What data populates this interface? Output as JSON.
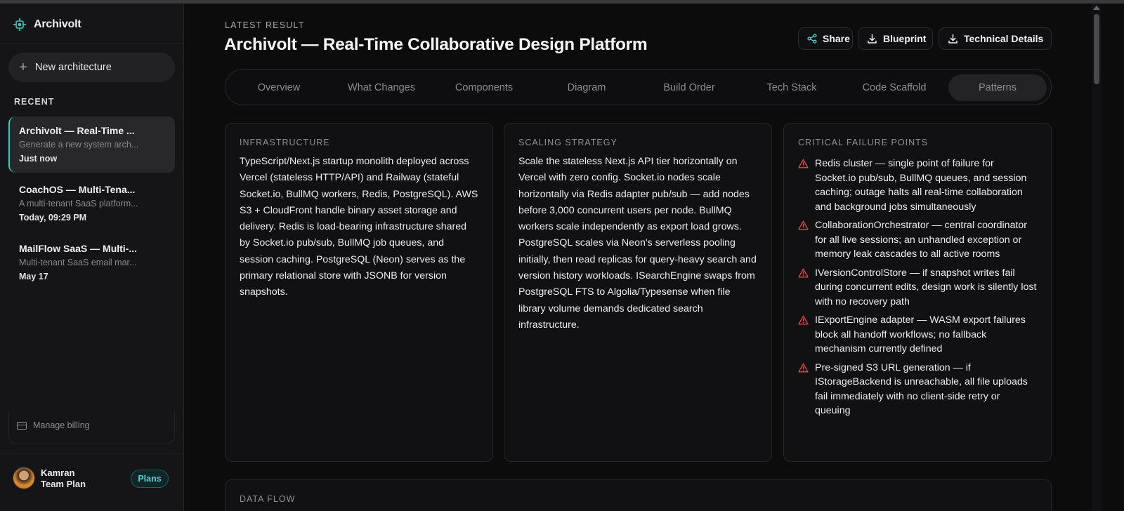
{
  "app": {
    "name": "Archivolt"
  },
  "sidebar": {
    "new_button": "New architecture",
    "recent_title": "RECENT",
    "recent": [
      {
        "title": "Archivolt — Real-Time ...",
        "desc": "Generate a new system arch...",
        "time": "Just now"
      },
      {
        "title": "CoachOS — Multi-Tena...",
        "desc": "A multi-tenant SaaS platform...",
        "time": "Today, 09:29 PM"
      },
      {
        "title": "MailFlow SaaS — Multi-...",
        "desc": "Multi-tenant SaaS email mar...",
        "time": "May 17"
      }
    ],
    "billing": "Manage billing",
    "user": {
      "name": "Kamran",
      "plan": "Team Plan",
      "plans_button": "Plans"
    }
  },
  "header": {
    "overline": "LATEST RESULT",
    "title": "Archivolt — Real-Time Collaborative Design Platform",
    "actions": {
      "share": "Share",
      "blueprint": "Blueprint",
      "technical": "Technical Details"
    }
  },
  "tabs": [
    {
      "label": "Overview"
    },
    {
      "label": "What Changes"
    },
    {
      "label": "Components"
    },
    {
      "label": "Diagram"
    },
    {
      "label": "Build Order"
    },
    {
      "label": "Tech Stack"
    },
    {
      "label": "Code Scaffold"
    },
    {
      "label": "Patterns",
      "active": true
    }
  ],
  "cards": {
    "infrastructure": {
      "label": "INFRASTRUCTURE",
      "text": "TypeScript/Next.js startup monolith deployed across Vercel (stateless HTTP/API) and Railway (stateful Socket.io, BullMQ workers, Redis, PostgreSQL). AWS S3 + CloudFront handle binary asset storage and delivery. Redis is load-bearing infrastructure shared by Socket.io pub/sub, BullMQ job queues, and session caching. PostgreSQL (Neon) serves as the primary relational store with JSONB for version snapshots."
    },
    "scaling": {
      "label": "SCALING STRATEGY",
      "text": "Scale the stateless Next.js API tier horizontally on Vercel with zero config. Socket.io nodes scale horizontally via Redis adapter pub/sub — add nodes before 3,000 concurrent users per node. BullMQ workers scale independently as export load grows. PostgreSQL scales via Neon's serverless pooling initially, then read replicas for query-heavy search and version history workloads. ISearchEngine swaps from PostgreSQL FTS to Algolia/Typesense when file library volume demands dedicated search infrastructure."
    },
    "failures": {
      "label": "CRITICAL FAILURE POINTS",
      "items": [
        "Redis cluster — single point of failure for Socket.io pub/sub, BullMQ queues, and session caching; outage halts all real-time collaboration and background jobs simultaneously",
        "CollaborationOrchestrator — central coordinator for all live sessions; an unhandled exception or memory leak cascades to all active rooms",
        "IVersionControlStore — if snapshot writes fail during concurrent edits, design work is silently lost with no recovery path",
        "IExportEngine adapter — WASM export failures block all handoff workflows; no fallback mechanism currently defined",
        "Pre-signed S3 URL generation — if IStorageBackend is unreachable, all file uploads fail immediately with no client-side retry or queuing"
      ]
    },
    "dataflow": {
      "label": "DATA FLOW"
    }
  },
  "colors": {
    "accent": "#2dd4bf",
    "warning": "#ef4444",
    "plans": "#4fd1d9"
  }
}
